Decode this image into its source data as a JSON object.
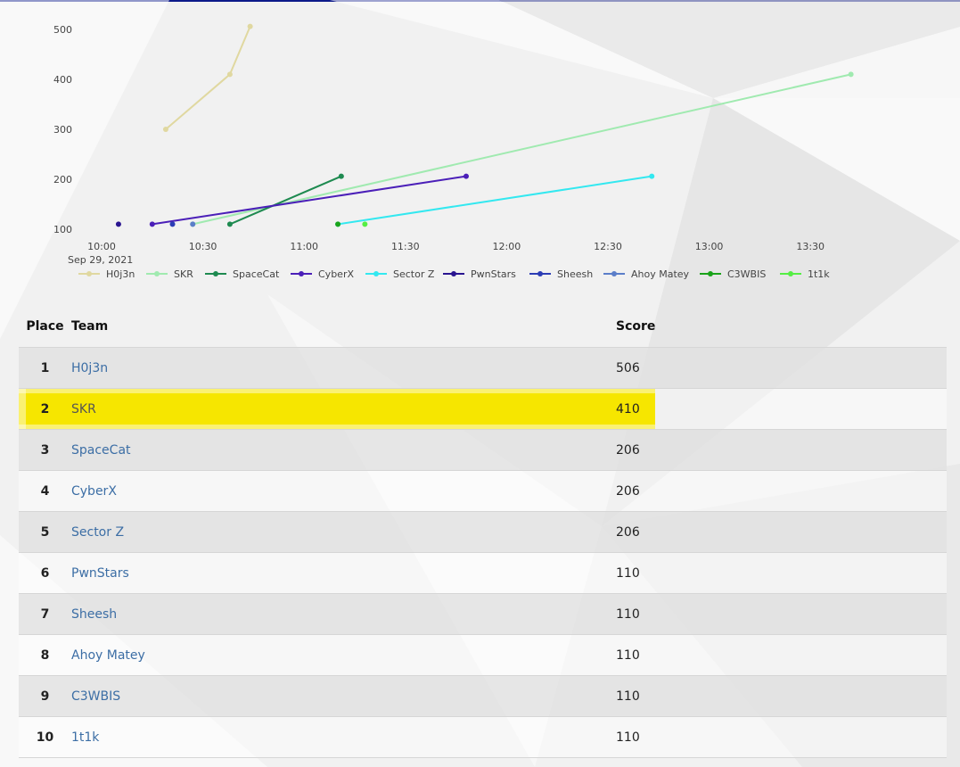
{
  "chart_data": {
    "type": "line",
    "x_date_label": "Sep 29, 2021",
    "x_ticks": [
      "10:00",
      "10:30",
      "11:00",
      "11:30",
      "12:00",
      "12:30",
      "13:00",
      "13:30"
    ],
    "x_range": [
      "10:00",
      "13:50"
    ],
    "y_ticks": [
      100,
      200,
      300,
      400,
      500
    ],
    "ylim": [
      100,
      510
    ],
    "legend_position": "bottom",
    "series": [
      {
        "name": "H0j3n",
        "color": "#e0d8a0",
        "points": [
          [
            "10:19",
            300
          ],
          [
            "10:38",
            410
          ],
          [
            "10:44",
            506
          ]
        ]
      },
      {
        "name": "SKR",
        "color": "#a0eab0",
        "points": [
          [
            "10:27",
            110
          ],
          [
            "13:42",
            410
          ]
        ]
      },
      {
        "name": "SpaceCat",
        "color": "#1e8a50",
        "points": [
          [
            "10:38",
            110
          ],
          [
            "11:11",
            206
          ]
        ]
      },
      {
        "name": "CyberX",
        "color": "#4b1fb8",
        "points": [
          [
            "10:15",
            110
          ],
          [
            "11:48",
            206
          ]
        ]
      },
      {
        "name": "Sector Z",
        "color": "#33e8f0",
        "points": [
          [
            "11:10",
            110
          ],
          [
            "12:43",
            206
          ]
        ]
      },
      {
        "name": "PwnStars",
        "color": "#2a1590",
        "points": [
          [
            "10:05",
            110
          ]
        ]
      },
      {
        "name": "Sheesh",
        "color": "#2c3db5",
        "points": [
          [
            "10:21",
            110
          ]
        ]
      },
      {
        "name": "Ahoy Matey",
        "color": "#5b7ec9",
        "points": [
          [
            "10:27",
            110
          ]
        ]
      },
      {
        "name": "C3WBIS",
        "color": "#1aa31a",
        "points": [
          [
            "11:10",
            110
          ]
        ]
      },
      {
        "name": "1t1k",
        "color": "#55ee44",
        "points": [
          [
            "11:18",
            110
          ]
        ]
      }
    ]
  },
  "table": {
    "headers": {
      "place": "Place",
      "team": "Team",
      "score": "Score"
    },
    "rows": [
      {
        "place": "1",
        "team": "H0j3n",
        "score": "506"
      },
      {
        "place": "2",
        "team": "SKR",
        "score": "410",
        "highlighted": true
      },
      {
        "place": "3",
        "team": "SpaceCat",
        "score": "206"
      },
      {
        "place": "4",
        "team": "CyberX",
        "score": "206"
      },
      {
        "place": "5",
        "team": "Sector Z",
        "score": "206"
      },
      {
        "place": "6",
        "team": "PwnStars",
        "score": "110"
      },
      {
        "place": "7",
        "team": "Sheesh",
        "score": "110"
      },
      {
        "place": "8",
        "team": "Ahoy Matey",
        "score": "110"
      },
      {
        "place": "9",
        "team": "C3WBIS",
        "score": "110"
      },
      {
        "place": "10",
        "team": "1t1k",
        "score": "110"
      }
    ]
  },
  "colors": {
    "top_bar": "#0d1a8a",
    "highlight": "#f6e600",
    "team_link": "#3c6ea5"
  }
}
